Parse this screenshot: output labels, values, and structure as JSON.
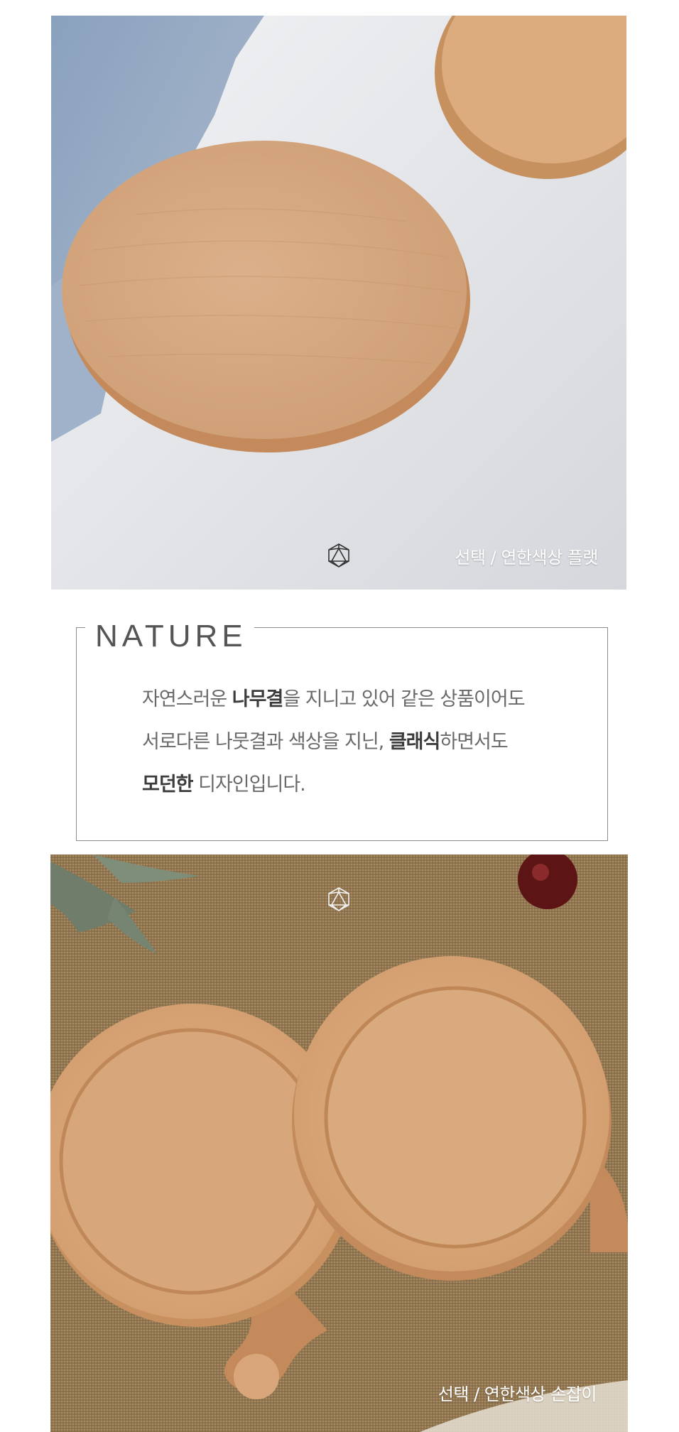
{
  "photo_top": {
    "caption": "선택 / 연한색상 플랫"
  },
  "nature": {
    "title": "NATURE",
    "line1_a": "자연스러운 ",
    "line1_b": "나무결",
    "line1_c": "을 지니고 있어  같은 상품이어도",
    "line2_a": "서로다른 나뭇결과 색상을 지닌, ",
    "line2_b": "클래식",
    "line2_c": "하면서도",
    "line3_a": "모던한",
    "line3_b": " 디자인입니다."
  },
  "photo_bottom": {
    "caption": "선택 / 연한색상 손잡이"
  },
  "colors": {
    "wood": "#d9a77a",
    "wood_dark": "#c28c5e",
    "burlap": "#8f7550",
    "table": "#e6e7ea"
  },
  "icons": [
    "icosahedron-logo-icon"
  ]
}
